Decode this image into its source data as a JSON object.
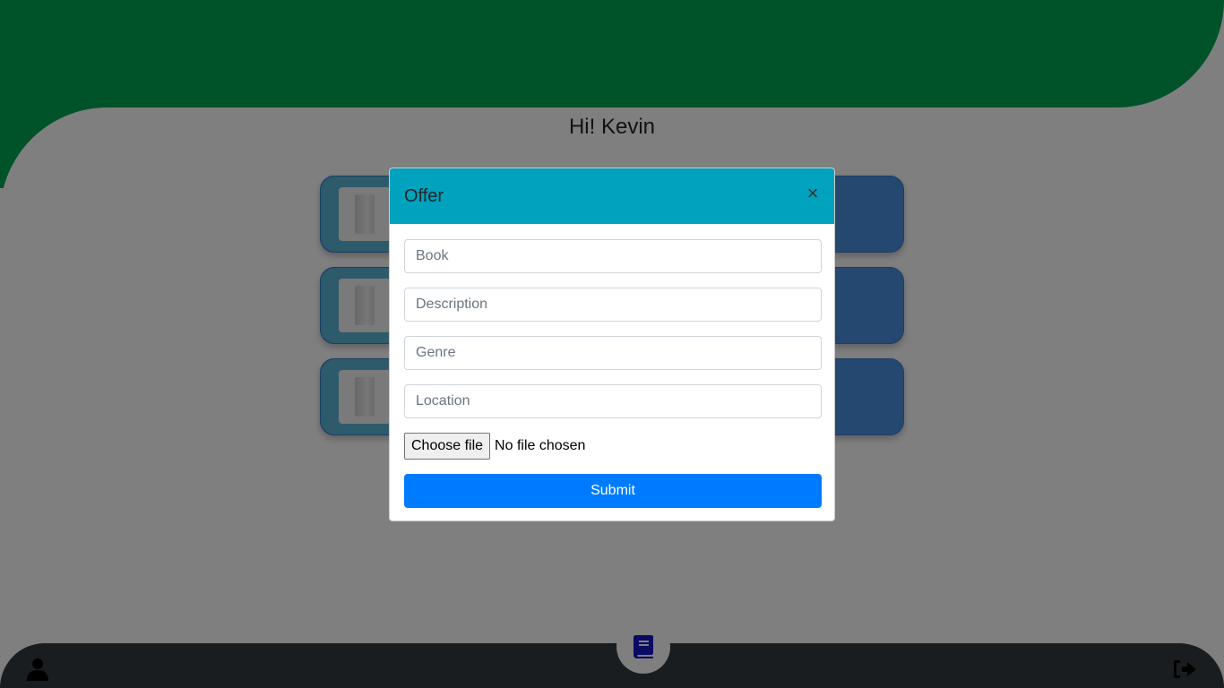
{
  "header": {
    "greeting": "Hi! Kevin"
  },
  "colors": {
    "brand_green": "#00A651",
    "card_blue": "#4A90E2",
    "modal_header": "#00A2BD",
    "primary_button": "#007BFF",
    "bottom_bar": "#343A40"
  },
  "cards": [
    {
      "thumbnail": "book-thumbnail"
    },
    {
      "thumbnail": "book-thumbnail"
    },
    {
      "thumbnail": "book-thumbnail"
    }
  ],
  "modal": {
    "title": "Offer",
    "close_label": "×",
    "fields": {
      "book": {
        "placeholder": "Book",
        "value": ""
      },
      "description": {
        "placeholder": "Description",
        "value": ""
      },
      "genre": {
        "placeholder": "Genre",
        "value": ""
      },
      "location": {
        "placeholder": "Location",
        "value": ""
      }
    },
    "file": {
      "button_label": "Choose file",
      "status": "No file chosen"
    },
    "submit_label": "Submit"
  },
  "bottom_nav": {
    "left_icon": "user-icon",
    "center_icon": "book-icon",
    "right_icon": "sign-out-icon"
  }
}
